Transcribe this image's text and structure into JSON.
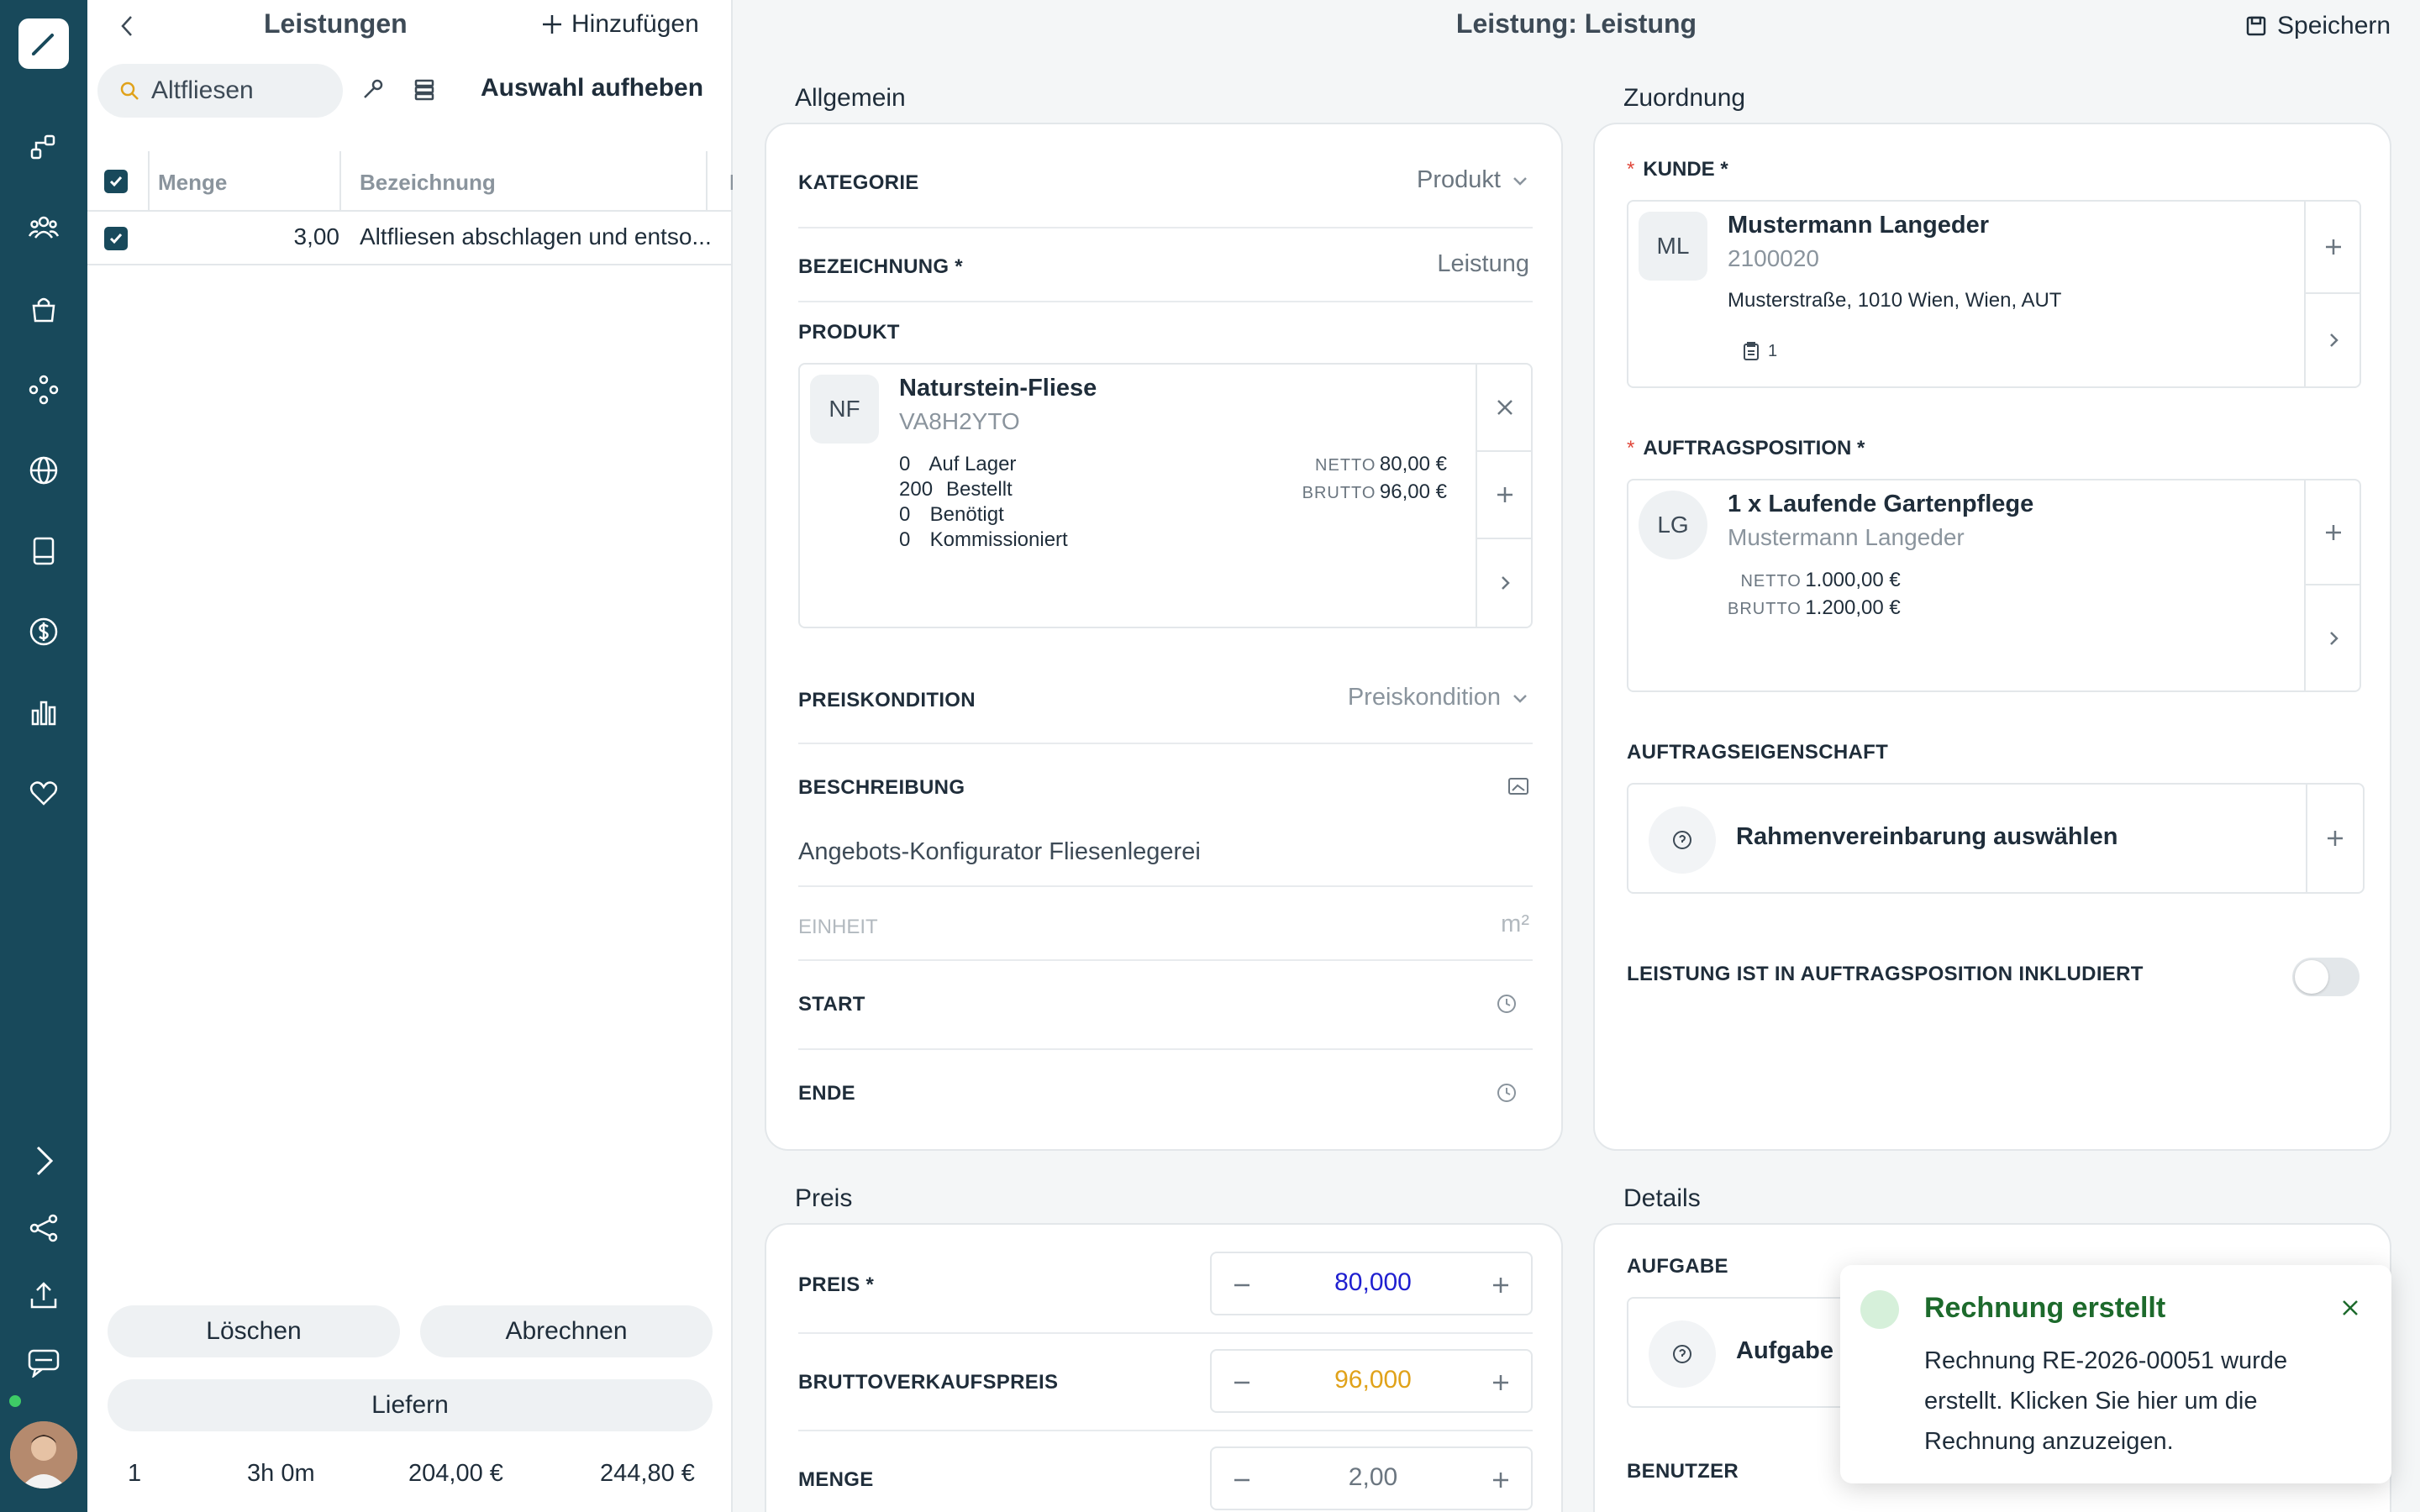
{
  "list": {
    "title": "Leistungen",
    "add_label": "Hinzufügen",
    "search_value": "Altfliesen",
    "deselect_label": "Auswahl aufheben",
    "columns": [
      "Menge",
      "Bezeichnung",
      "E"
    ],
    "rows": [
      {
        "qty": "3,00",
        "name": "Altfliesen abschlagen und entso..."
      }
    ],
    "delete_label": "Löschen",
    "bill_label": "Abrechnen",
    "deliver_label": "Liefern",
    "footer": {
      "count": "1",
      "time": "3h 0m",
      "net": "204,00 €",
      "gross": "244,80 €"
    }
  },
  "main": {
    "title": "Leistung: Leistung",
    "save_label": "Speichern",
    "general": {
      "section": "Allgemein",
      "kategorie_label": "KATEGORIE",
      "kategorie_value": "Produkt",
      "bezeichnung_label": "BEZEICHNUNG *",
      "bezeichnung_value": "Leistung",
      "produkt_label": "PRODUKT",
      "product": {
        "initials": "NF",
        "name": "Naturstein-Fliese",
        "code": "VA8H2YTO",
        "stock": [
          {
            "qty": "0",
            "label": "Auf Lager"
          },
          {
            "qty": "200",
            "label": "Bestellt"
          },
          {
            "qty": "0",
            "label": "Benötigt"
          },
          {
            "qty": "0",
            "label": "Kommissioniert"
          }
        ],
        "netto_label": "NETTO",
        "netto_value": "80,00 €",
        "brutto_label": "BRUTTO",
        "brutto_value": "96,00 €"
      },
      "preiskondition_label": "PREISKONDITION",
      "preiskondition_value": "Preiskondition",
      "beschreibung_label": "BESCHREIBUNG",
      "beschreibung_value": "Angebots-Konfigurator Fliesenlegerei",
      "einheit_label": "EINHEIT",
      "einheit_value": "m²",
      "start_label": "START",
      "ende_label": "ENDE"
    },
    "zuordnung": {
      "section": "Zuordnung",
      "kunde_label": "KUNDE *",
      "customer": {
        "initials": "ML",
        "name": "Mustermann Langeder",
        "number": "2100020",
        "address": "Musterstraße, 1010 Wien, Wien, AUT",
        "doc_count": "1"
      },
      "auftragsposition_label": "AUFTRAGSPOSITION *",
      "position": {
        "initials": "LG",
        "qty": "1 x",
        "name": "Laufende Gartenpflege",
        "customer": "Mustermann Langeder",
        "netto_label": "NETTO",
        "netto_value": "1.000,00 €",
        "brutto_label": "BRUTTO",
        "brutto_value": "1.200,00 €"
      },
      "eigenschaft_label": "AUFTRAGSEIGENSCHAFT",
      "eigenschaft_value": "Rahmenvereinbarung auswählen",
      "inkludiert_label": "LEISTUNG IST IN AUFTRAGSPOSITION INKLUDIERT",
      "inkludiert_on": false
    },
    "preis": {
      "section": "Preis",
      "preis_label": "PREIS *",
      "preis_value": "80,000",
      "brutto_label": "BRUTTOVERKAUFSPREIS",
      "brutto_value": "96,000",
      "menge_label": "MENGE",
      "menge_value": "2,00"
    },
    "details": {
      "section": "Details",
      "aufgabe_label": "AUFGABE",
      "aufgabe_value": "Aufgabe a",
      "benutzer_label": "BENUTZER"
    }
  },
  "toast": {
    "title": "Rechnung erstellt",
    "message": "Rechnung RE-2026-00051 wurde erstellt. Klicken Sie hier um die Rechnung anzuzeigen."
  },
  "colors": {
    "rail": "#18495b",
    "preis_value": "#1f1fd0",
    "brutto_value": "#e0a21a",
    "toast_title": "#1d6a2c",
    "required_star": "#e0473a"
  }
}
